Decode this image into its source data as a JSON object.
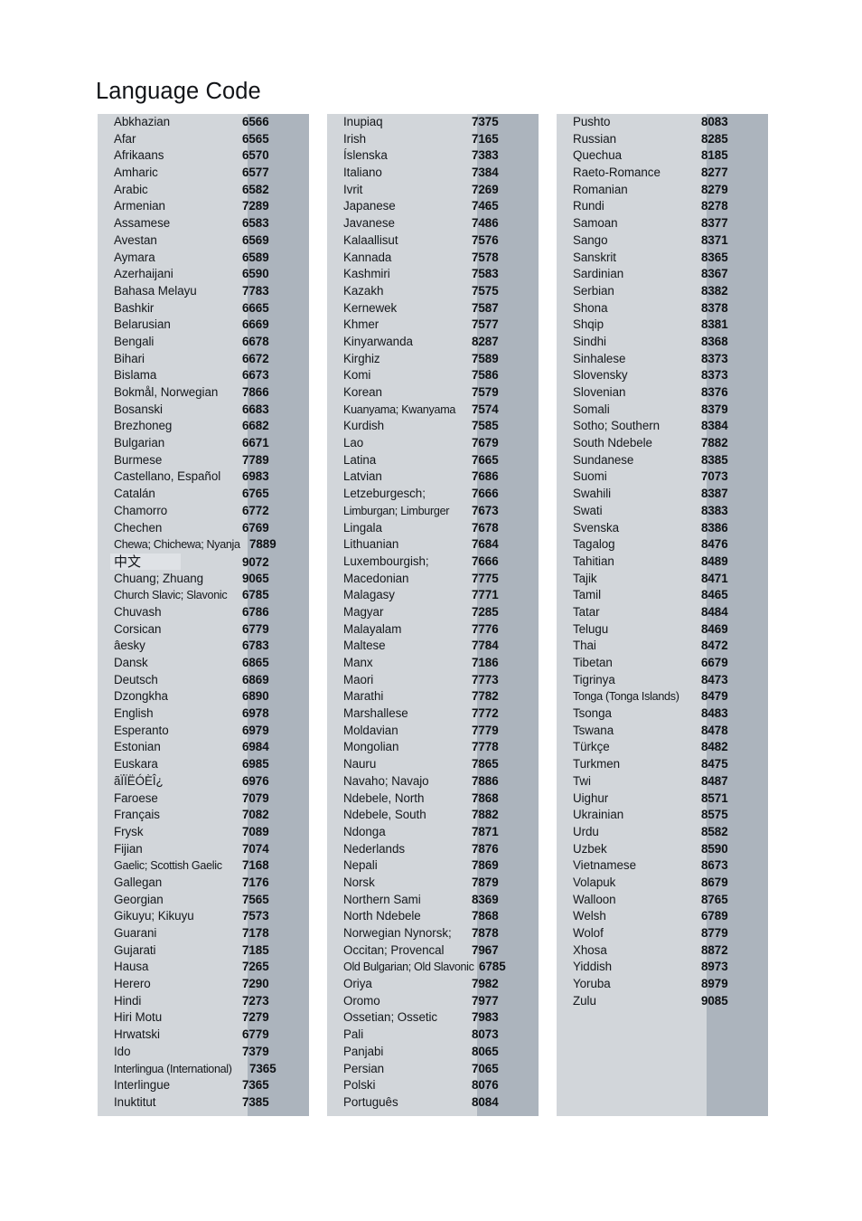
{
  "document": {
    "title": "Language Code"
  },
  "table": {
    "columns": [
      {
        "id": "column-1",
        "rows": [
          {
            "name": "Abkhazian",
            "code": "6566"
          },
          {
            "name": "Afar",
            "code": "6565"
          },
          {
            "name": "Afrikaans",
            "code": "6570"
          },
          {
            "name": "Amharic",
            "code": "6577"
          },
          {
            "name": "Arabic",
            "code": "6582"
          },
          {
            "name": "Armenian",
            "code": "7289"
          },
          {
            "name": "Assamese",
            "code": "6583"
          },
          {
            "name": "Avestan",
            "code": "6569"
          },
          {
            "name": "Aymara",
            "code": "6589"
          },
          {
            "name": "Azerhaijani",
            "code": "6590"
          },
          {
            "name": "Bahasa Melayu",
            "code": "7783"
          },
          {
            "name": "Bashkir",
            "code": "6665"
          },
          {
            "name": "Belarusian",
            "code": "6669"
          },
          {
            "name": "Bengali",
            "code": "6678"
          },
          {
            "name": "Bihari",
            "code": "6672"
          },
          {
            "name": "Bislama",
            "code": "6673"
          },
          {
            "name": "Bokmål, Norwegian",
            "code": "7866"
          },
          {
            "name": "Bosanski",
            "code": "6683"
          },
          {
            "name": "Brezhoneg",
            "code": "6682"
          },
          {
            "name": "Bulgarian",
            "code": "6671"
          },
          {
            "name": "Burmese",
            "code": "7789"
          },
          {
            "name": "Castellano, Español",
            "code": "6983"
          },
          {
            "name": "Catalán",
            "code": "6765"
          },
          {
            "name": "Chamorro",
            "code": "6772"
          },
          {
            "name": "Chechen",
            "code": "6769"
          },
          {
            "name": "Chewa; Chichewa; Nyanja",
            "code": "7889",
            "style": "overflow"
          },
          {
            "name": "中文",
            "code": "9072",
            "style": "cjk"
          },
          {
            "name": "Chuang; Zhuang",
            "code": "9065"
          },
          {
            "name": "Church Slavic; Slavonic",
            "code": "6785",
            "style": "tight"
          },
          {
            "name": "Chuvash",
            "code": "6786"
          },
          {
            "name": "Corsican",
            "code": "6779"
          },
          {
            "name": "âesky",
            "code": "6783"
          },
          {
            "name": "Dansk",
            "code": "6865"
          },
          {
            "name": "Deutsch",
            "code": "6869"
          },
          {
            "name": "Dzongkha",
            "code": "6890"
          },
          {
            "name": "English",
            "code": "6978"
          },
          {
            "name": "Esperanto",
            "code": "6979"
          },
          {
            "name": "Estonian",
            "code": "6984"
          },
          {
            "name": "Euskara",
            "code": "6985"
          },
          {
            "name": "ãÏÏËÓÈÎ¿",
            "code": "6976"
          },
          {
            "name": "Faroese",
            "code": "7079"
          },
          {
            "name": "Français",
            "code": "7082"
          },
          {
            "name": "Frysk",
            "code": "7089"
          },
          {
            "name": "Fijian",
            "code": "7074"
          },
          {
            "name": "Gaelic; Scottish Gaelic",
            "code": "7168",
            "style": "tight"
          },
          {
            "name": "Gallegan",
            "code": "7176"
          },
          {
            "name": "Georgian",
            "code": "7565"
          },
          {
            "name": "Gikuyu; Kikuyu",
            "code": "7573"
          },
          {
            "name": "Guarani",
            "code": "7178"
          },
          {
            "name": "Gujarati",
            "code": "7185"
          },
          {
            "name": "Hausa",
            "code": "7265"
          },
          {
            "name": "Herero",
            "code": "7290"
          },
          {
            "name": "Hindi",
            "code": "7273"
          },
          {
            "name": "Hiri Motu",
            "code": "7279"
          },
          {
            "name": "Hrwatski",
            "code": "6779"
          },
          {
            "name": "Ido",
            "code": "7379"
          },
          {
            "name": "Interlingua (International)",
            "code": "7365",
            "style": "overflow"
          },
          {
            "name": "Interlingue",
            "code": "7365"
          },
          {
            "name": "Inuktitut",
            "code": "7385"
          }
        ]
      },
      {
        "id": "column-2",
        "rows": [
          {
            "name": "Inupiaq",
            "code": "7375"
          },
          {
            "name": "Irish",
            "code": "7165"
          },
          {
            "name": "Íslenska",
            "code": "7383"
          },
          {
            "name": "Italiano",
            "code": "7384"
          },
          {
            "name": "Ivrit",
            "code": "7269"
          },
          {
            "name": "Japanese",
            "code": "7465"
          },
          {
            "name": "Javanese",
            "code": "7486"
          },
          {
            "name": "Kalaallisut",
            "code": "7576"
          },
          {
            "name": "Kannada",
            "code": "7578"
          },
          {
            "name": "Kashmiri",
            "code": "7583"
          },
          {
            "name": "Kazakh",
            "code": "7575"
          },
          {
            "name": "Kernewek",
            "code": "7587"
          },
          {
            "name": "Khmer",
            "code": "7577"
          },
          {
            "name": "Kinyarwanda",
            "code": "8287"
          },
          {
            "name": "Kirghiz",
            "code": "7589"
          },
          {
            "name": "Komi",
            "code": "7586"
          },
          {
            "name": "Korean",
            "code": "7579"
          },
          {
            "name": "Kuanyama; Kwanyama",
            "code": "7574",
            "style": "tight"
          },
          {
            "name": "Kurdish",
            "code": "7585"
          },
          {
            "name": "Lao",
            "code": "7679"
          },
          {
            "name": "Latina",
            "code": "7665"
          },
          {
            "name": "Latvian",
            "code": "7686"
          },
          {
            "name": "Letzeburgesch;",
            "code": "7666"
          },
          {
            "name": "Limburgan; Limburger",
            "code": "7673",
            "style": "tight"
          },
          {
            "name": "Lingala",
            "code": "7678"
          },
          {
            "name": "Lithuanian",
            "code": "7684"
          },
          {
            "name": "Luxembourgish;",
            "code": "7666"
          },
          {
            "name": "Macedonian",
            "code": "7775"
          },
          {
            "name": "Malagasy",
            "code": "7771"
          },
          {
            "name": "Magyar",
            "code": "7285"
          },
          {
            "name": "Malayalam",
            "code": "7776"
          },
          {
            "name": "Maltese",
            "code": "7784"
          },
          {
            "name": "Manx",
            "code": "7186"
          },
          {
            "name": "Maori",
            "code": "7773"
          },
          {
            "name": "Marathi",
            "code": "7782"
          },
          {
            "name": "Marshallese",
            "code": "7772"
          },
          {
            "name": "Moldavian",
            "code": "7779"
          },
          {
            "name": "Mongolian",
            "code": "7778"
          },
          {
            "name": "Nauru",
            "code": "7865"
          },
          {
            "name": "Navaho; Navajo",
            "code": "7886"
          },
          {
            "name": "Ndebele, North",
            "code": "7868"
          },
          {
            "name": "Ndebele, South",
            "code": "7882"
          },
          {
            "name": "Ndonga",
            "code": "7871"
          },
          {
            "name": "Nederlands",
            "code": "7876"
          },
          {
            "name": "Nepali",
            "code": "7869"
          },
          {
            "name": "Norsk",
            "code": "7879"
          },
          {
            "name": "Northern Sami",
            "code": "8369"
          },
          {
            "name": "North Ndebele",
            "code": "7868"
          },
          {
            "name": "Norwegian Nynorsk;",
            "code": "7878"
          },
          {
            "name": "Occitan; Provencal",
            "code": "7967"
          },
          {
            "name": "Old Bulgarian; Old Slavonic",
            "code": "6785",
            "style": "overflow"
          },
          {
            "name": "Oriya",
            "code": "7982"
          },
          {
            "name": "Oromo",
            "code": "7977"
          },
          {
            "name": "Ossetian; Ossetic",
            "code": "7983"
          },
          {
            "name": "Pali",
            "code": "8073"
          },
          {
            "name": "Panjabi",
            "code": "8065"
          },
          {
            "name": "Persian",
            "code": "7065"
          },
          {
            "name": "Polski",
            "code": "8076"
          },
          {
            "name": "Português",
            "code": "8084"
          }
        ]
      },
      {
        "id": "column-3",
        "rows": [
          {
            "name": "Pushto",
            "code": "8083"
          },
          {
            "name": "Russian",
            "code": "8285"
          },
          {
            "name": "Quechua",
            "code": "8185"
          },
          {
            "name": "Raeto-Romance",
            "code": "8277"
          },
          {
            "name": "Romanian",
            "code": "8279"
          },
          {
            "name": "Rundi",
            "code": "8278"
          },
          {
            "name": "Samoan",
            "code": "8377"
          },
          {
            "name": "Sango",
            "code": "8371"
          },
          {
            "name": "Sanskrit",
            "code": "8365"
          },
          {
            "name": "Sardinian",
            "code": "8367"
          },
          {
            "name": "Serbian",
            "code": "8382"
          },
          {
            "name": "Shona",
            "code": "8378"
          },
          {
            "name": "Shqip",
            "code": "8381"
          },
          {
            "name": "Sindhi",
            "code": "8368"
          },
          {
            "name": "Sinhalese",
            "code": "8373"
          },
          {
            "name": "Slovensky",
            "code": "8373"
          },
          {
            "name": "Slovenian",
            "code": "8376"
          },
          {
            "name": "Somali",
            "code": "8379"
          },
          {
            "name": "Sotho; Southern",
            "code": "8384"
          },
          {
            "name": "South Ndebele",
            "code": "7882"
          },
          {
            "name": "Sundanese",
            "code": "8385"
          },
          {
            "name": "Suomi",
            "code": "7073"
          },
          {
            "name": "Swahili",
            "code": "8387"
          },
          {
            "name": "Swati",
            "code": "8383"
          },
          {
            "name": "Svenska",
            "code": "8386"
          },
          {
            "name": "Tagalog",
            "code": "8476"
          },
          {
            "name": "Tahitian",
            "code": "8489"
          },
          {
            "name": "Tajik",
            "code": "8471"
          },
          {
            "name": "Tamil",
            "code": "8465"
          },
          {
            "name": "Tatar",
            "code": "8484"
          },
          {
            "name": "Telugu",
            "code": "8469"
          },
          {
            "name": "Thai",
            "code": "8472"
          },
          {
            "name": "Tibetan",
            "code": "6679"
          },
          {
            "name": "Tigrinya",
            "code": "8473"
          },
          {
            "name": "Tonga (Tonga Islands)",
            "code": "8479",
            "style": "tight"
          },
          {
            "name": "Tsonga",
            "code": "8483"
          },
          {
            "name": "Tswana",
            "code": "8478"
          },
          {
            "name": "Türkçe",
            "code": "8482"
          },
          {
            "name": "Turkmen",
            "code": "8475"
          },
          {
            "name": "Twi",
            "code": "8487"
          },
          {
            "name": "Uighur",
            "code": "8571"
          },
          {
            "name": "Ukrainian",
            "code": "8575"
          },
          {
            "name": "Urdu",
            "code": "8582"
          },
          {
            "name": "Uzbek",
            "code": "8590"
          },
          {
            "name": "Vietnamese",
            "code": "8673"
          },
          {
            "name": "Volapuk",
            "code": "8679"
          },
          {
            "name": "Walloon",
            "code": "8765"
          },
          {
            "name": "Welsh",
            "code": "6789"
          },
          {
            "name": "Wolof",
            "code": "8779"
          },
          {
            "name": "Xhosa",
            "code": "8872"
          },
          {
            "name": "Yiddish",
            "code": "8973"
          },
          {
            "name": "Yoruba",
            "code": "8979"
          },
          {
            "name": "Zulu",
            "code": "9085"
          },
          {
            "name": "",
            "code": ""
          },
          {
            "name": "",
            "code": ""
          },
          {
            "name": "",
            "code": ""
          },
          {
            "name": "",
            "code": ""
          },
          {
            "name": "",
            "code": ""
          },
          {
            "name": "",
            "code": ""
          }
        ]
      }
    ]
  },
  "colors": {
    "page_background": "#ffffff",
    "name_cell_background": "#d2d6da",
    "code_cell_background": "#acb4bd",
    "cjk_highlight": "#dfe2e6",
    "text": "#14171b"
  }
}
